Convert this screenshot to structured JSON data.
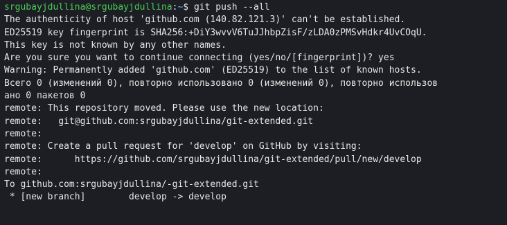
{
  "terminal": {
    "prompt": {
      "user_host": "srgubayjdullina@srgubayjdullina",
      "separator": ":",
      "path": "~",
      "symbol": "$ ",
      "command": "git push --all"
    },
    "lines": [
      "The authenticity of host 'github.com (140.82.121.3)' can't be established.",
      "ED25519 key fingerprint is SHA256:+DiY3wvvV6TuJJhbpZisF/zLDA0zPMSvHdkr4UvCOqU.",
      "This key is not known by any other names.",
      "Are you sure you want to continue connecting (yes/no/[fingerprint])? yes",
      "Warning: Permanently added 'github.com' (ED25519) to the list of known hosts.",
      "Всего 0 (изменений 0), повторно использовано 0 (изменений 0), повторно использов",
      "ано 0 пакетов 0",
      "remote: This repository moved. Please use the new location:",
      "remote:   git@github.com:srgubayjdullina/git-extended.git",
      "remote:",
      "remote: Create a pull request for 'develop' on GitHub by visiting:",
      "remote:      https://github.com/srgubayjdullina/git-extended/pull/new/develop",
      "remote:",
      "To github.com:srgubayjdullina/-git-extended.git",
      " * [new branch]        develop -> develop"
    ]
  },
  "colors": {
    "background": "#1c1e23",
    "text": "#e6e6e6",
    "prompt_user": "#4ccb5a",
    "prompt_path": "#6aa8ff"
  }
}
